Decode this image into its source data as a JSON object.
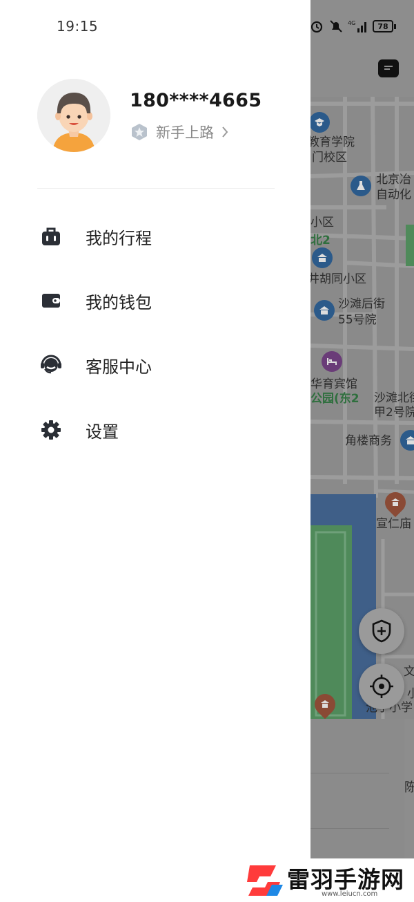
{
  "status_bar": {
    "time": "19:15",
    "battery": "78"
  },
  "profile": {
    "phone": "180****4665",
    "level": "新手上路"
  },
  "menu": [
    {
      "label": "我的行程",
      "icon": "suitcase-icon"
    },
    {
      "label": "我的钱包",
      "icon": "wallet-icon"
    },
    {
      "label": "客服中心",
      "icon": "headset-icon"
    },
    {
      "label": "设置",
      "icon": "gear-icon"
    }
  ],
  "map": {
    "labels": [
      "教育学院",
      "门校区",
      "北京冶",
      "自动化",
      "小区",
      "北2",
      "井胡同小区",
      "沙滩后街",
      "55号院",
      "华育宾馆",
      "公园(东2",
      "沙滩北街",
      "甲2号院",
      "角楼商务",
      "宣仁庙",
      "文",
      "小",
      "池子小学",
      "陈"
    ]
  },
  "watermark": {
    "name": "雷羽手游网",
    "url": "www.leiucn.com"
  },
  "colors": {
    "accent": "#ff3b3b",
    "map_water": "#3f5f88",
    "map_park": "#4f8a5a"
  }
}
